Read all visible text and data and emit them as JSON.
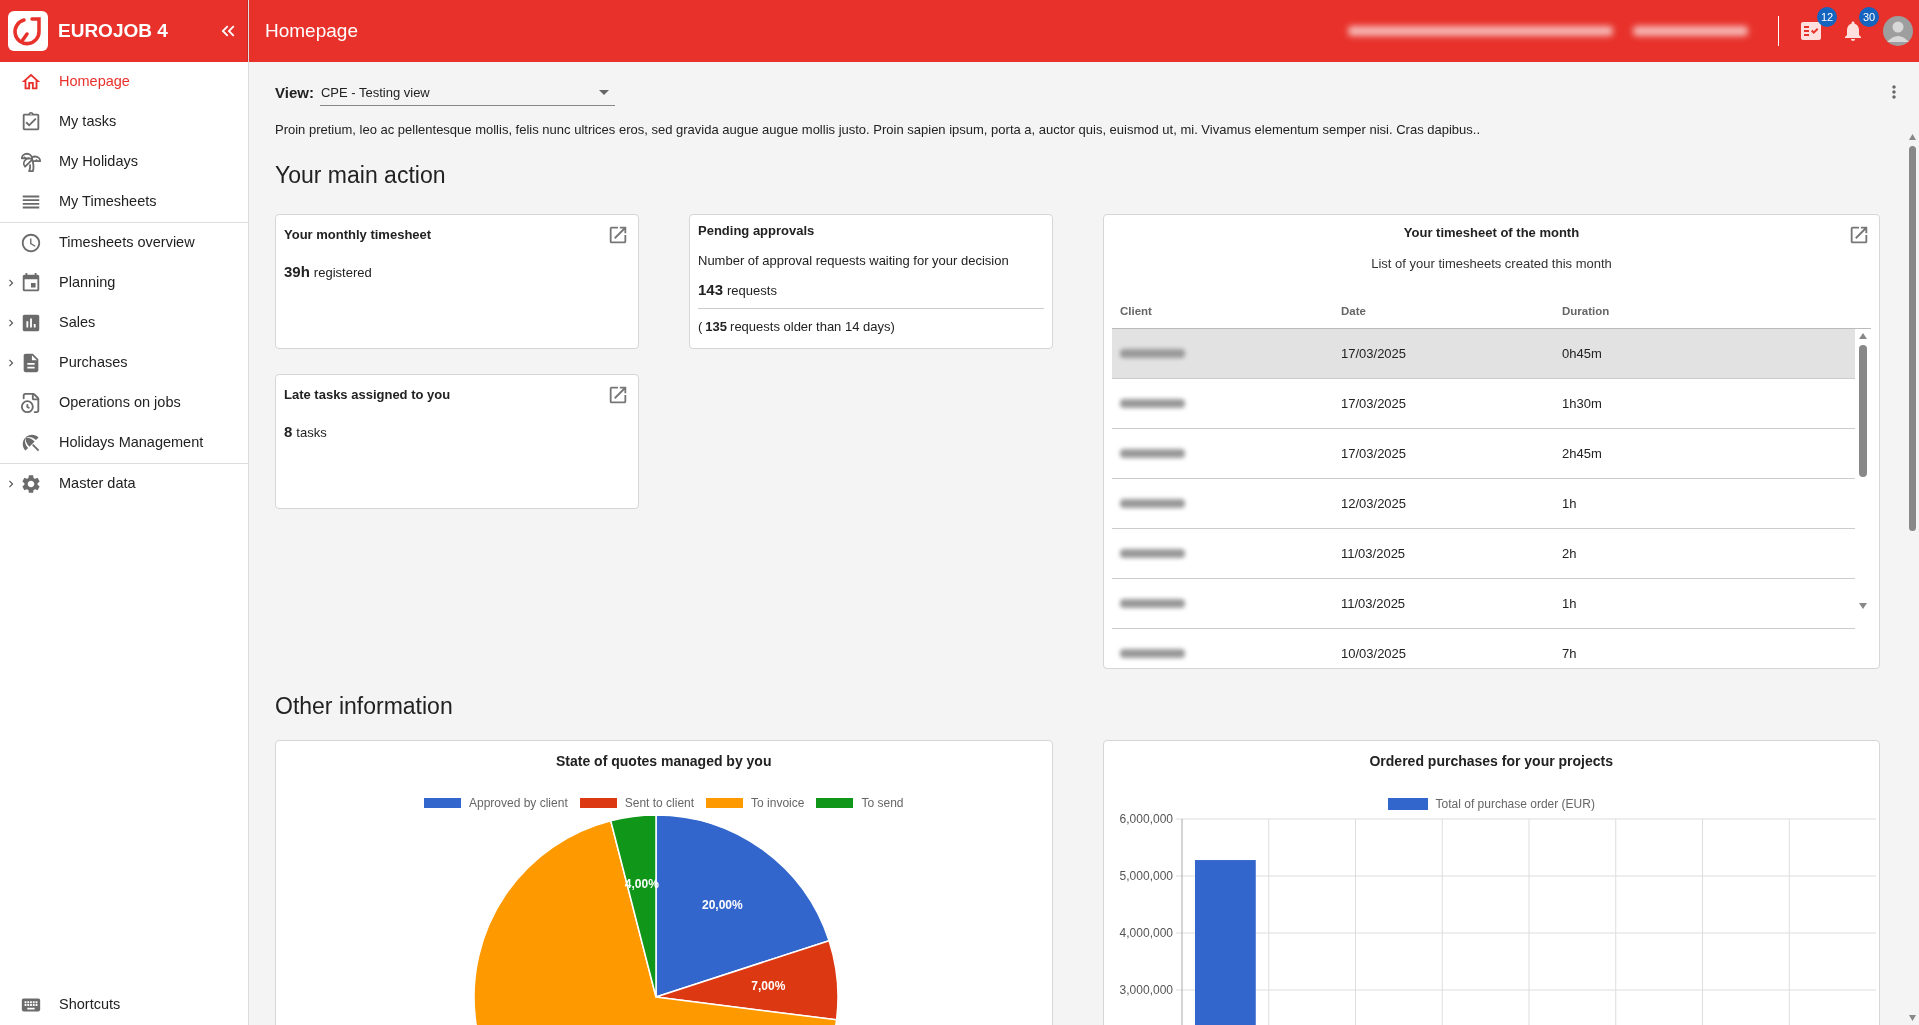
{
  "header": {
    "app_name": "EUROJOB 4",
    "page_title": "Homepage",
    "tasks_badge": "12",
    "notifications_badge": "30"
  },
  "sidebar": {
    "sections": [
      [
        {
          "label": "Homepage",
          "selected": true,
          "expandable": false
        },
        {
          "label": "My tasks",
          "selected": false,
          "expandable": false
        },
        {
          "label": "My Holidays",
          "selected": false,
          "expandable": false
        },
        {
          "label": "My Timesheets",
          "selected": false,
          "expandable": false
        }
      ],
      [
        {
          "label": "Timesheets overview",
          "selected": false,
          "expandable": false
        },
        {
          "label": "Planning",
          "selected": false,
          "expandable": true
        },
        {
          "label": "Sales",
          "selected": false,
          "expandable": true
        },
        {
          "label": "Purchases",
          "selected": false,
          "expandable": true
        },
        {
          "label": "Operations on jobs",
          "selected": false,
          "expandable": false
        },
        {
          "label": "Holidays Management",
          "selected": false,
          "expandable": false
        }
      ],
      [
        {
          "label": "Master data",
          "selected": false,
          "expandable": true
        }
      ]
    ],
    "footer_item": "Shortcuts"
  },
  "view": {
    "label": "View:",
    "value": "CPE - Testing view"
  },
  "intro": "Proin pretium, leo ac pellentesque mollis, felis nunc ultrices eros, sed gravida augue augue mollis justo. Proin sapien ipsum, porta a, auctor quis, euismod ut, mi. Vivamus elementum semper nisi. Cras dapibus..",
  "main_action": {
    "title": "Your main action",
    "monthly_timesheet": {
      "title": "Your monthly timesheet",
      "value": "39h",
      "unit": "registered"
    },
    "pending_approvals": {
      "title": "Pending approvals",
      "description": "Number of approval requests waiting for your decision",
      "value": "143",
      "unit": "requests",
      "older_open": "(",
      "older_value": "135",
      "older_text": "requests older than 14 days)"
    },
    "late_tasks": {
      "title": "Late tasks assigned to you",
      "value": "8",
      "unit": "tasks"
    },
    "timesheet_table": {
      "title": "Your timesheet of the month",
      "subtitle": "List of your timesheets created this month",
      "columns": [
        "Client",
        "Date",
        "Duration"
      ],
      "rows": [
        {
          "date": "17/03/2025",
          "duration": "0h45m",
          "selected": true
        },
        {
          "date": "17/03/2025",
          "duration": "1h30m",
          "selected": false
        },
        {
          "date": "17/03/2025",
          "duration": "2h45m",
          "selected": false
        },
        {
          "date": "12/03/2025",
          "duration": "1h",
          "selected": false
        },
        {
          "date": "11/03/2025",
          "duration": "2h",
          "selected": false
        },
        {
          "date": "11/03/2025",
          "duration": "1h",
          "selected": false
        },
        {
          "date": "10/03/2025",
          "duration": "7h",
          "selected": false
        }
      ]
    }
  },
  "other_information": {
    "title": "Other information",
    "quotes_chart": {
      "chart_data": {
        "type": "pie",
        "title": "State of quotes managed by you",
        "categories": [
          "Approved by client",
          "Sent to client",
          "To invoice",
          "To send"
        ],
        "colors": [
          "#3366cc",
          "#dc3912",
          "#ff9900",
          "#109618"
        ],
        "values": [
          20,
          7,
          69,
          4
        ],
        "value_labels": [
          "20,00%",
          "7,00%",
          null,
          "4,00%"
        ]
      }
    },
    "purchases_chart": {
      "chart_data": {
        "type": "bar",
        "title": "Ordered purchases for your projects",
        "series": [
          {
            "name": "Total of purchase order (EUR)",
            "color": "#3366cc",
            "values": [
              5280000
            ]
          }
        ],
        "grid": true,
        "ylim": [
          0,
          6000000
        ],
        "yticks": [
          {
            "value": 6000000,
            "label": "6,000,000"
          },
          {
            "value": 5000000,
            "label": "5,000,000"
          },
          {
            "value": 4000000,
            "label": "4,000,000"
          },
          {
            "value": 3000000,
            "label": "3,000,000"
          }
        ]
      }
    }
  }
}
